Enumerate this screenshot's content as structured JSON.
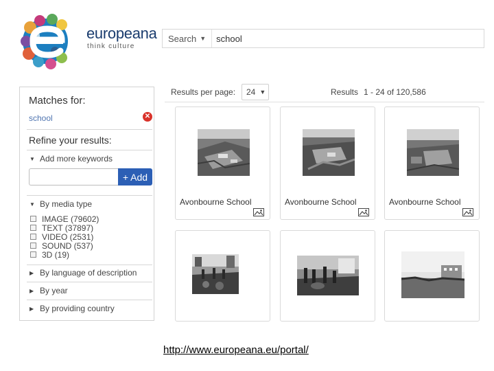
{
  "logo": {
    "wordmark": "europeana",
    "tagline": "think culture"
  },
  "search": {
    "scope_label": "Search",
    "query": "school"
  },
  "sidebar": {
    "matches_label": "Matches for:",
    "query_tag": "school",
    "refine_label": "Refine your results:",
    "add_keywords_label": "Add more keywords",
    "add_button_label": "+ Add",
    "media_type_label": "By media type",
    "media_types": [
      {
        "label": "IMAGE (79602)"
      },
      {
        "label": "TEXT (37897)"
      },
      {
        "label": "VIDEO (2531)"
      },
      {
        "label": "SOUND (537)"
      },
      {
        "label": "3D (19)"
      }
    ],
    "language_label": "By language of description",
    "year_label": "By year",
    "country_label": "By providing country"
  },
  "results": {
    "per_page_label": "Results per page:",
    "per_page_value": "24",
    "count_label": "Results",
    "count_range": "1 - 24 of 120,586",
    "items": [
      {
        "title": "Avonbourne School",
        "type_icon": "image-icon"
      },
      {
        "title": "Avonbourne School",
        "type_icon": "image-icon"
      },
      {
        "title": "Avonbourne School",
        "type_icon": "image-icon"
      },
      {
        "title": "",
        "type_icon": ""
      },
      {
        "title": "",
        "type_icon": ""
      },
      {
        "title": "",
        "type_icon": ""
      }
    ]
  },
  "footer": {
    "url": "http://www.europeana.eu/portal/"
  },
  "colors": {
    "brand_blue": "#1a3c6e",
    "link_blue": "#5075b0",
    "add_button": "#2c5fb5",
    "remove_red": "#d9322a"
  }
}
